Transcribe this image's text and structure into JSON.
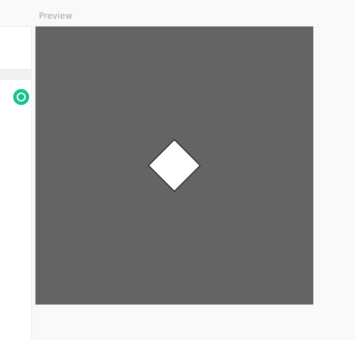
{
  "preview": {
    "label": "Preview",
    "canvas_color": "#646464",
    "shape": {
      "type": "diamond",
      "fill": "#ffffff",
      "stroke": "#000000"
    }
  },
  "sidebar": {
    "status_icon": "status-check-icon",
    "status_color": "#16c28f"
  }
}
